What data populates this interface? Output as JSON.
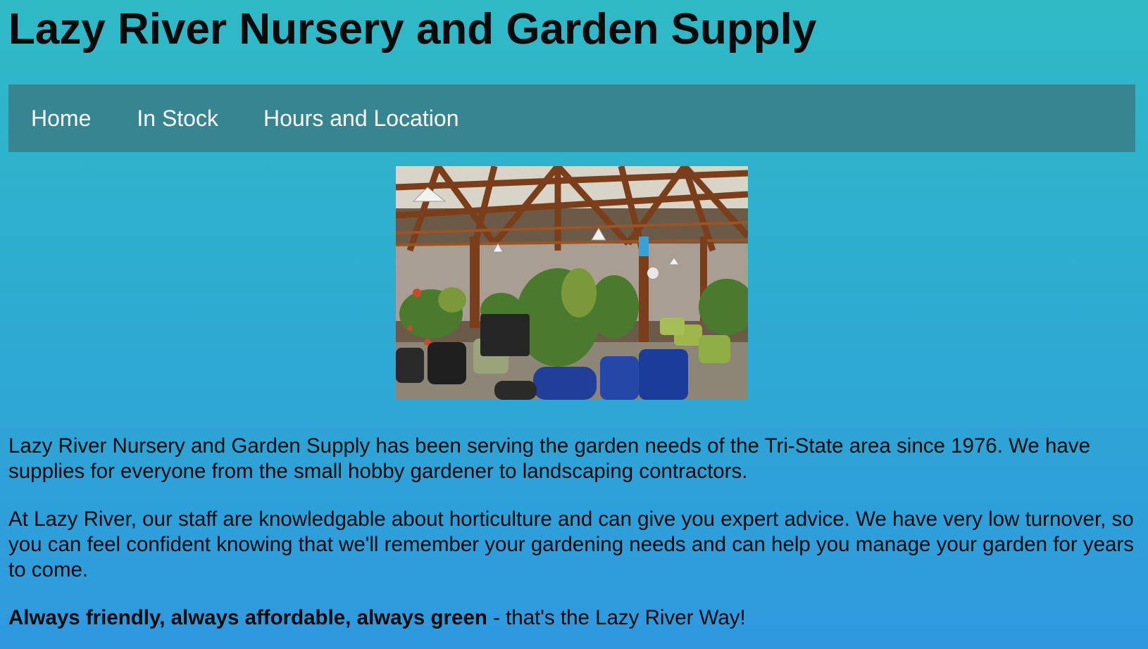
{
  "header": {
    "title": "Lazy River Nursery and Garden Supply"
  },
  "nav": {
    "items": [
      {
        "label": "Home"
      },
      {
        "label": "In Stock"
      },
      {
        "label": "Hours and Location"
      }
    ]
  },
  "main": {
    "paragraphs": [
      "Lazy River Nursery and Garden Supply has been serving the garden needs of the Tri-State area since 1976. We have supplies for everyone from the small hobby gardener to landscaping contractors.",
      "At Lazy River, our staff are knowledgable about horticulture and can give you expert advice. We have very low turnover, so you can feel confident knowing that we'll remember your gardening needs and can help you manage your garden for years to come."
    ],
    "tagline": {
      "bold": "Always friendly, always affordable, always green",
      "rest": " - that's the Lazy River Way!"
    }
  },
  "colors": {
    "background_top": "#2fbac6",
    "background_bottom": "#2f98de",
    "nav_bar": "#368591",
    "nav_text": "#ffffff"
  }
}
